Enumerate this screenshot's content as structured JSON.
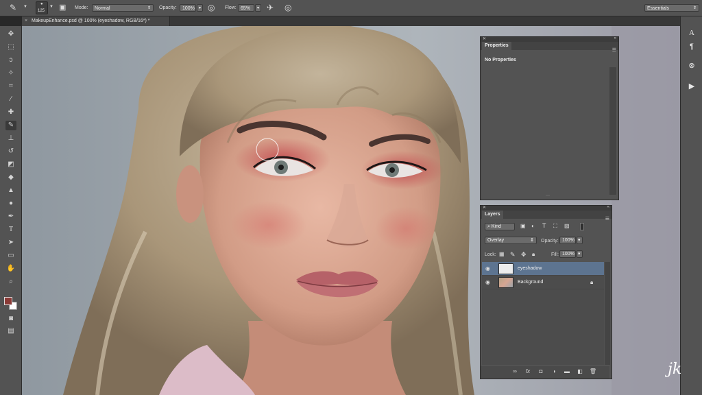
{
  "options_bar": {
    "brush_size": "125",
    "mode_label": "Mode:",
    "mode_value": "Normal",
    "opacity_label": "Opacity:",
    "opacity_value": "100%",
    "flow_label": "Flow:",
    "flow_value": "65%",
    "workspace": "Essentials"
  },
  "document_tab": {
    "close_glyph": "×",
    "title": "MakeupEnhance.psd @ 100% (eyeshadow, RGB/16*) *"
  },
  "properties_panel": {
    "tab_label": "Properties",
    "content": "No Properties"
  },
  "layers_panel": {
    "tab_label": "Layers",
    "filter_kind": "Kind",
    "blend_mode": "Overlay",
    "opacity_label": "Opacity:",
    "opacity_value": "100%",
    "lock_label": "Lock:",
    "fill_label": "Fill:",
    "fill_value": "100%",
    "layers": [
      {
        "name": "eyeshadow",
        "selected": true
      },
      {
        "name": "Background",
        "selected": false,
        "locked": true
      }
    ]
  },
  "colors": {
    "foreground": "#8b3a36",
    "background": "#ffffff",
    "selection": "#5d7490"
  },
  "watermark": "jk",
  "icons": {
    "tools": [
      "move-icon",
      "marquee-icon",
      "lasso-icon",
      "magic-wand-icon",
      "crop-icon",
      "eyedropper-icon",
      "healing-icon",
      "brush-icon",
      "clone-stamp-icon",
      "history-brush-icon",
      "eraser-icon",
      "paint-bucket-icon",
      "blur-icon",
      "dodge-icon",
      "pen-icon",
      "type-icon",
      "path-select-icon",
      "shape-icon",
      "hand-icon",
      "zoom-icon"
    ]
  }
}
